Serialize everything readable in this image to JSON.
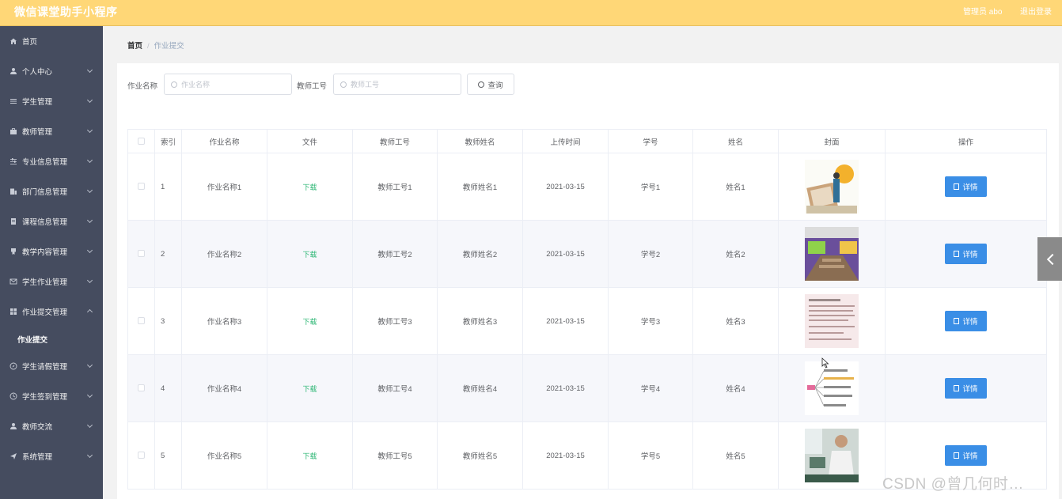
{
  "app": {
    "title": "微信课堂助手小程序",
    "admin_label": "管理员 abo",
    "logout_label": "退出登录"
  },
  "sidebar": {
    "items": [
      {
        "label": "首页",
        "icon": "home-icon"
      },
      {
        "label": "个人中心",
        "icon": "user-icon"
      },
      {
        "label": "学生管理",
        "icon": "list-icon"
      },
      {
        "label": "教师管理",
        "icon": "briefcase-icon"
      },
      {
        "label": "专业信息管理",
        "icon": "sliders-icon"
      },
      {
        "label": "部门信息管理",
        "icon": "building-icon"
      },
      {
        "label": "课程信息管理",
        "icon": "document-icon"
      },
      {
        "label": "教学内容管理",
        "icon": "award-icon"
      },
      {
        "label": "学生作业管理",
        "icon": "mail-icon"
      },
      {
        "label": "作业提交管理",
        "icon": "grid-icon",
        "expanded": true
      },
      {
        "label": "学生请假管理",
        "icon": "compass-icon"
      },
      {
        "label": "学生签到管理",
        "icon": "clock-icon"
      },
      {
        "label": "教师交流",
        "icon": "user-icon"
      },
      {
        "label": "系统管理",
        "icon": "send-icon"
      }
    ],
    "submenu": {
      "label": "作业提交"
    }
  },
  "breadcrumb": {
    "home": "首页",
    "separator": "/",
    "current": "作业提交"
  },
  "search": {
    "name_label": "作业名称",
    "name_placeholder": "作业名称",
    "teacher_label": "教师工号",
    "teacher_placeholder": "教师工号",
    "button_label": "查询"
  },
  "table": {
    "headers": [
      "索引",
      "作业名称",
      "文件",
      "教师工号",
      "教师姓名",
      "上传时间",
      "学号",
      "姓名",
      "封面",
      "操作"
    ],
    "download_label": "下载",
    "detail_label": "详情",
    "rows": [
      {
        "index": "1",
        "name": "作业名称1",
        "teacher_no": "教师工号1",
        "teacher_name": "教师姓名1",
        "time": "2021-03-15",
        "student_no": "学号1",
        "student_name": "姓名1"
      },
      {
        "index": "2",
        "name": "作业名称2",
        "teacher_no": "教师工号2",
        "teacher_name": "教师姓名2",
        "time": "2021-03-15",
        "student_no": "学号2",
        "student_name": "姓名2"
      },
      {
        "index": "3",
        "name": "作业名称3",
        "teacher_no": "教师工号3",
        "teacher_name": "教师姓名3",
        "time": "2021-03-15",
        "student_no": "学号3",
        "student_name": "姓名3"
      },
      {
        "index": "4",
        "name": "作业名称4",
        "teacher_no": "教师工号4",
        "teacher_name": "教师姓名4",
        "time": "2021-03-15",
        "student_no": "学号4",
        "student_name": "姓名4"
      },
      {
        "index": "5",
        "name": "作业名称5",
        "teacher_no": "教师工号5",
        "teacher_name": "教师姓名5",
        "time": "2021-03-15",
        "student_no": "学号5",
        "student_name": "姓名5"
      }
    ]
  },
  "watermark": "CSDN @曾几何时…",
  "colors": {
    "topbar": "#ffd777",
    "sidebar": "#454c5f",
    "primary_button": "#3a8ee6",
    "download_link": "#2bb673"
  }
}
